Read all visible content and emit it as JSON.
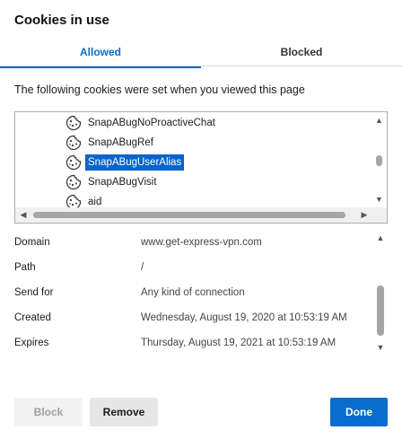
{
  "dialog": {
    "title": "Cookies in use"
  },
  "tabs": [
    {
      "label": "Allowed",
      "selected": true
    },
    {
      "label": "Blocked",
      "selected": false
    }
  ],
  "intro_text": "The following cookies were set when you viewed this page",
  "cookie_list": {
    "icon": "cookie-icon",
    "items": [
      {
        "label": "SnapABugNoProactiveChat",
        "selected": false
      },
      {
        "label": "SnapABugRef",
        "selected": false
      },
      {
        "label": "SnapABugUserAlias",
        "selected": true
      },
      {
        "label": "SnapABugVisit",
        "selected": false
      },
      {
        "label": "aid",
        "selected": false
      }
    ]
  },
  "details": [
    {
      "label": "Domain",
      "value": "www.get-express-vpn.com"
    },
    {
      "label": "Path",
      "value": "/"
    },
    {
      "label": "Send for",
      "value": "Any kind of connection"
    },
    {
      "label": "Created",
      "value": "Wednesday, August 19, 2020 at 10:53:19 AM"
    },
    {
      "label": "Expires",
      "value": "Thursday, August 19, 2021 at 10:53:19 AM"
    }
  ],
  "buttons": {
    "block": "Block",
    "remove": "Remove",
    "done": "Done"
  },
  "colors": {
    "accent": "#0a6ccc",
    "selection": "#0a64c9",
    "disabled_text": "#a0a0a0"
  }
}
